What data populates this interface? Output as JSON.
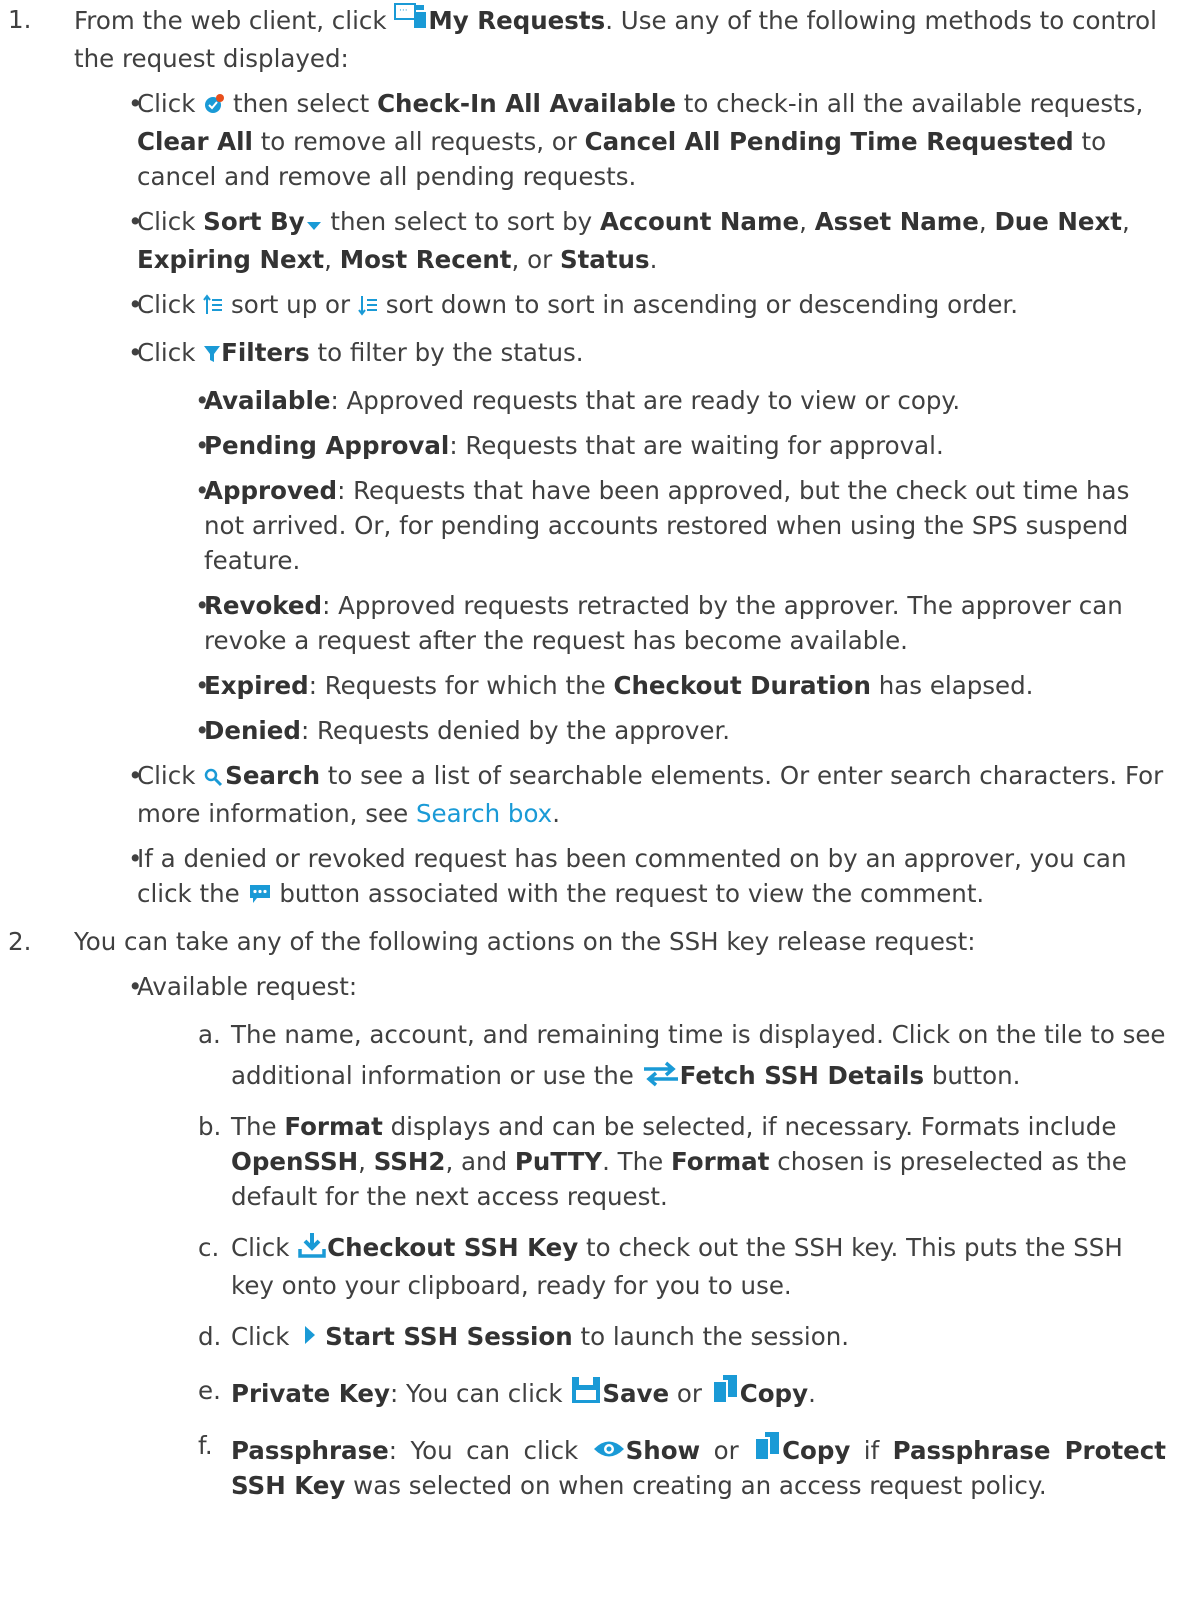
{
  "step1": {
    "number": "1.",
    "pre": "From the web client, click ",
    "my_requests": "My Requests",
    "post": ". Use any of the following methods to control the request displayed:"
  },
  "bullets1": {
    "checkin": {
      "t1": "Click ",
      "t2": " then select ",
      "b1": "Check-In All Available",
      "t3": " to check-in all the available requests, ",
      "b2": "Clear All",
      "t4": " to remove all requests, or ",
      "b3": "Cancel All Pending Time Requested",
      "t5": " to cancel and remove all pending requests."
    },
    "sortby": {
      "t1": "Click ",
      "b1": "Sort By",
      "t2": " then select to sort by ",
      "b2": "Account Name",
      "s1": ", ",
      "b3": "Asset Name",
      "s2": ", ",
      "b4": "Due Next",
      "s3": ", ",
      "b5": "Expiring Next",
      "s4": ", ",
      "b6": "Most Recent",
      "s5": ", or ",
      "b7": "Status",
      "s6": "."
    },
    "sortorder": {
      "t1": "Click ",
      "t2": " sort up or ",
      "t3": " sort down to sort in ascending or descending order."
    },
    "filters": {
      "t1": "Click ",
      "b1": "Filters",
      "t2": " to filter by the status."
    },
    "statuses": [
      {
        "name": "Available",
        "desc": ": Approved requests that are ready to view or copy."
      },
      {
        "name": "Pending Approval",
        "desc": ": Requests that are waiting for approval."
      },
      {
        "name": "Approved",
        "desc": ": Requests that have been approved, but the check out time has not arrived. Or, for pending accounts restored when using the SPS suspend feature."
      },
      {
        "name": "Revoked",
        "desc": ": Approved requests retracted by the approver. The approver can revoke a request after the request has become available."
      },
      {
        "name": "Expired",
        "desc": ": Requests for which the "
      },
      {
        "name": "Denied",
        "desc": ": Requests denied by the approver."
      }
    ],
    "expired_bold": "Checkout Duration",
    "expired_tail": " has elapsed.",
    "search": {
      "t1": "Click ",
      "b1": "Search",
      "t2": " to see a list of searchable elements. Or enter search characters. For more information, see ",
      "link": "Search box",
      "t3": "."
    },
    "comment": {
      "t1": "If a denied or revoked request has been commented on by an approver, you can click the ",
      "t2": " button associated with the request to view the comment."
    }
  },
  "step2": {
    "number": "2.",
    "text": "You can take any of the following actions on the SSH key release request:",
    "available": "Available request:",
    "items": {
      "a": {
        "m": "a.",
        "t1": "The name, account, and remaining time is displayed. Click on the tile to see additional information or use the ",
        "b1": "Fetch SSH Details",
        "t2": " button."
      },
      "b": {
        "m": "b.",
        "t1": "The ",
        "b1": "Format",
        "t2": " displays and can be selected, if necessary. Formats include ",
        "b2": "OpenSSH",
        "t3": ", ",
        "b3": "SSH2",
        "t4": ", and ",
        "b4": "PuTTY",
        "t5": ". The ",
        "b5": "Format",
        "t6": " chosen is preselected as the default for the next access request."
      },
      "c": {
        "m": "c.",
        "t1": "Click ",
        "b1": "Checkout SSH Key",
        "t2": " to check out the SSH key. This puts the SSH key onto your clipboard, ready for you to use."
      },
      "d": {
        "m": "d.",
        "t1": "Click ",
        "b1": "Start SSH Session",
        "t2": " to launch the session."
      },
      "e": {
        "m": "e.",
        "b0": "Private Key",
        "t1": ": You can click ",
        "b1": "Save",
        "t2": " or ",
        "b2": "Copy",
        "t3": "."
      },
      "f": {
        "m": "f.",
        "b0": "Passphrase",
        "t1": ": You can click ",
        "b1": "Show",
        "t2": " or ",
        "b2": "Copy",
        "t3": "  if ",
        "b3": "Passphrase Protect SSH Key",
        "t4": " was selected on when creating an access request policy."
      }
    }
  },
  "colors": {
    "accent": "#1a9ad6",
    "text": "#404040"
  }
}
